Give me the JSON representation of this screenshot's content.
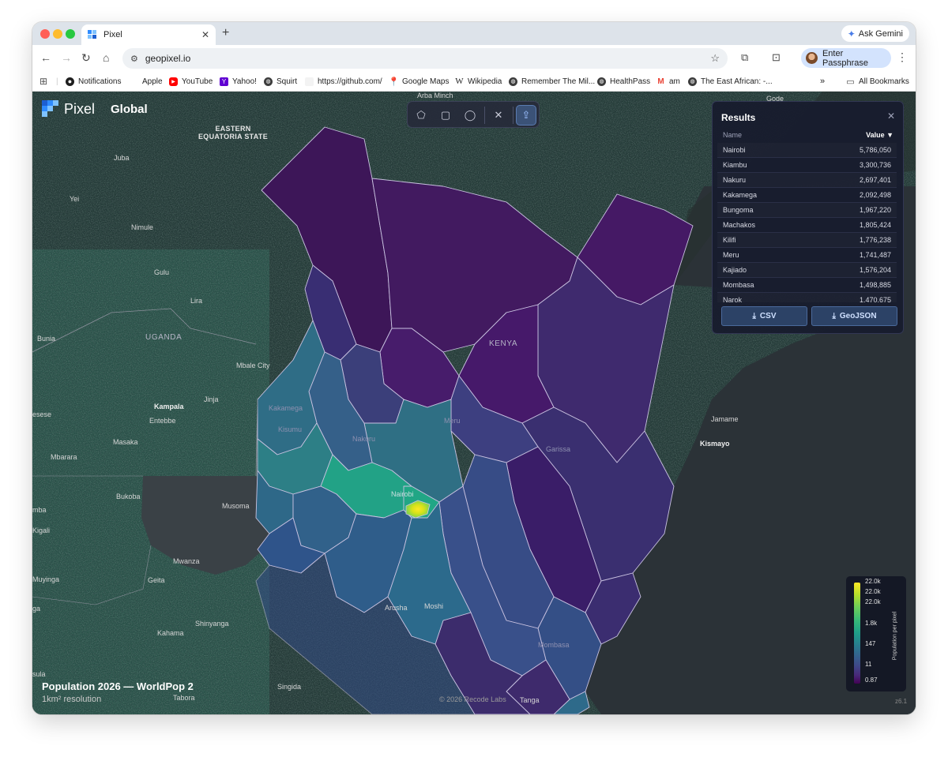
{
  "browser": {
    "tab_title": "Pixel",
    "new_tab": "+",
    "ask_gemini": "Ask Gemini",
    "url": "geopixel.io",
    "profile_label": "Enter Passphrase",
    "bookmarks": [
      {
        "label": "Notifications",
        "icon": "github-icon"
      },
      {
        "label": "Apple",
        "icon": "apple-icon"
      },
      {
        "label": "YouTube",
        "icon": "youtube-icon"
      },
      {
        "label": "Yahoo!",
        "icon": "yahoo-icon"
      },
      {
        "label": "Squirt",
        "icon": "globe-icon"
      },
      {
        "label": "https://github.com/",
        "icon": "blank-page-icon"
      },
      {
        "label": "Google Maps",
        "icon": "maps-pin-icon"
      },
      {
        "label": "Wikipedia",
        "icon": "wikipedia-icon"
      },
      {
        "label": "Remember The Mil...",
        "icon": "globe-icon"
      },
      {
        "label": "HealthPass",
        "icon": "globe-icon"
      },
      {
        "label": "am",
        "icon": "gmail-icon"
      },
      {
        "label": "The East African: -...",
        "icon": "globe-icon"
      }
    ],
    "overflow": "»",
    "all_bookmarks": "All Bookmarks"
  },
  "app": {
    "brand": "Pixel",
    "scope": "Global",
    "dataset_title": "Population 2026 — WorldPop 2",
    "dataset_subtitle": "1km² resolution",
    "credit": "© 2026 Recode Labs",
    "zoom": "z6.1",
    "tools": [
      "polygon-tool",
      "rectangle-tool",
      "circle-tool",
      "clear-tool",
      "upload-tool"
    ]
  },
  "results": {
    "title": "Results",
    "col_name": "Name",
    "col_value": "Value ▼",
    "rows": [
      {
        "name": "Nairobi",
        "value": "5,786,050"
      },
      {
        "name": "Kiambu",
        "value": "3,300,736"
      },
      {
        "name": "Nakuru",
        "value": "2,697,401"
      },
      {
        "name": "Kakamega",
        "value": "2,092,498"
      },
      {
        "name": "Bungoma",
        "value": "1,967,220"
      },
      {
        "name": "Machakos",
        "value": "1,805,424"
      },
      {
        "name": "Kilifi",
        "value": "1,776,238"
      },
      {
        "name": "Meru",
        "value": "1,741,487"
      },
      {
        "name": "Kajiado",
        "value": "1,576,204"
      },
      {
        "name": "Mombasa",
        "value": "1,498,885"
      },
      {
        "name": "Narok",
        "value": "1,470,675"
      }
    ],
    "csv_label": "CSV",
    "geojson_label": "GeoJSON"
  },
  "legend": {
    "title": "Population per pixel",
    "ticks": [
      "22.0k",
      "22.0k",
      "22.0k",
      "1.8k",
      "147",
      "11",
      "0.87"
    ]
  },
  "map_labels": {
    "eastern_equatoria": "EASTERN\nEQUATORIA STATE",
    "juba": "Juba",
    "yei": "Yei",
    "nimule": "Nimule",
    "gulu": "Gulu",
    "lira": "Lira",
    "uganda": "UGANDA",
    "bunia": "Bunia",
    "mbale": "Mbale City",
    "kampala": "Kampala",
    "jinja": "Jinja",
    "entebbe": "Entebbe",
    "esese": "esese",
    "masaka": "Masaka",
    "mbarara": "Mbarara",
    "bukoba": "Bukoba",
    "musoma": "Musoma",
    "mba": "mba",
    "kigali": "Kigali",
    "mwanza": "Mwanza",
    "muyinga": "Muyinga",
    "geita": "Geita",
    "ga": "ga",
    "kahama": "Kahama",
    "shinyanga": "Shinyanga",
    "arusha": "Arusha",
    "moshi": "Moshi",
    "singida": "Singida",
    "tabora": "Tabora",
    "tanga": "Tanga",
    "sula": "sula",
    "arba_minch": "Arba Minch",
    "gode": "Gode",
    "kenya": "KENYA",
    "jamame": "Jamame",
    "kismayo": "Kismayo",
    "kakamega": "Kakamega",
    "kisumu": "Kisumu",
    "nakuru": "Nakuru",
    "meru": "Meru",
    "garissa": "Garissa",
    "nairobi": "Nairobi",
    "mombasa": "Mombasa"
  },
  "colors": {
    "accent": "#5a7bb0",
    "panel_bg": "#181c2e",
    "viridis_low": "#440154",
    "viridis_high": "#fde725"
  }
}
